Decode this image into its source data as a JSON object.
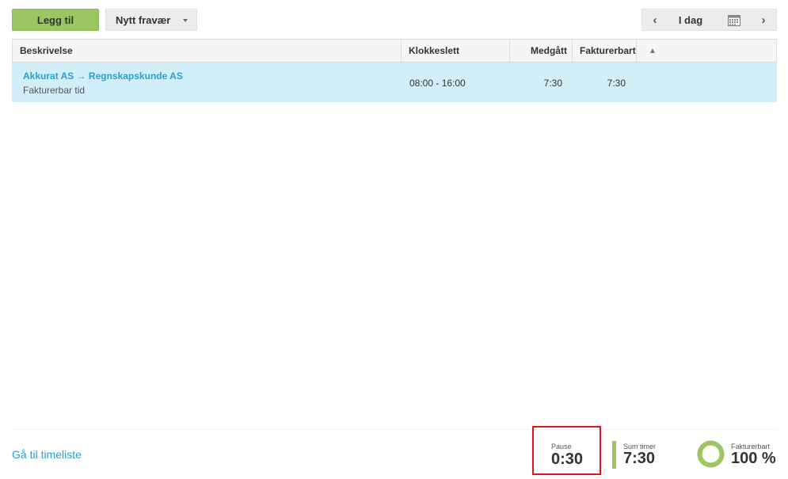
{
  "toolbar": {
    "add_label": "Legg til",
    "absence_label": "Nytt fravær",
    "date_label": "I dag",
    "prev_glyph": "‹",
    "next_glyph": "›",
    "calendar_icon": "calendar-icon"
  },
  "table": {
    "columns": {
      "description": "Beskrivelse",
      "clock": "Klokkeslett",
      "spent": "Medgått",
      "billable": "Fakturerbart",
      "sort_glyph": "▲"
    },
    "rows": [
      {
        "customer": "Akkurat AS → Regnskapskunde AS",
        "type": "Fakturerbar tid",
        "clock": "08:00 - 16:00",
        "spent": "7:30",
        "billable": "7:30"
      }
    ]
  },
  "footer": {
    "goto_link": "Gå til timeliste",
    "pause_label": "Pause",
    "pause_value": "0:30",
    "sum_label": "Sum timer",
    "sum_value": "7:30",
    "billable_label": "Fakturerbart",
    "billable_value": "100 %",
    "billable_fraction": 1.0
  },
  "colors": {
    "accent_green": "#9bc763",
    "link_blue": "#2a9fd0",
    "selected_row": "#d1eef9",
    "highlight_red": "#e0161c"
  }
}
